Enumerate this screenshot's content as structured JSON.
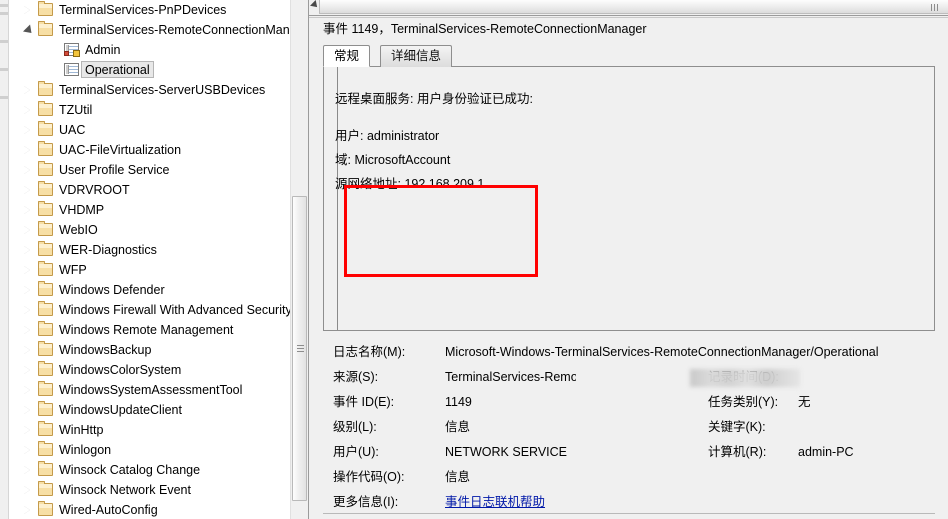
{
  "tree": {
    "name": "event-log-channel-tree",
    "items": [
      {
        "label": "TerminalServices-PnPDevices",
        "indent": 0,
        "state": "collapsed",
        "icon": "folder-icon"
      },
      {
        "label": "TerminalServices-RemoteConnectionMan",
        "indent": 0,
        "state": "expanded",
        "icon": "folder-icon"
      },
      {
        "label": "Admin",
        "indent": 1,
        "state": "leaf",
        "icon": "log-admin-icon"
      },
      {
        "label": "Operational",
        "indent": 1,
        "state": "leaf",
        "icon": "log-icon",
        "selected": true
      },
      {
        "label": "TerminalServices-ServerUSBDevices",
        "indent": 0,
        "state": "collapsed",
        "icon": "folder-icon"
      },
      {
        "label": "TZUtil",
        "indent": 0,
        "state": "collapsed",
        "icon": "folder-icon"
      },
      {
        "label": "UAC",
        "indent": 0,
        "state": "collapsed",
        "icon": "folder-icon"
      },
      {
        "label": "UAC-FileVirtualization",
        "indent": 0,
        "state": "collapsed",
        "icon": "folder-icon"
      },
      {
        "label": "User Profile Service",
        "indent": 0,
        "state": "collapsed",
        "icon": "folder-icon"
      },
      {
        "label": "VDRVROOT",
        "indent": 0,
        "state": "collapsed",
        "icon": "folder-icon"
      },
      {
        "label": "VHDMP",
        "indent": 0,
        "state": "collapsed",
        "icon": "folder-icon"
      },
      {
        "label": "WebIO",
        "indent": 0,
        "state": "collapsed",
        "icon": "folder-icon"
      },
      {
        "label": "WER-Diagnostics",
        "indent": 0,
        "state": "collapsed",
        "icon": "folder-icon"
      },
      {
        "label": "WFP",
        "indent": 0,
        "state": "collapsed",
        "icon": "folder-icon"
      },
      {
        "label": "Windows Defender",
        "indent": 0,
        "state": "collapsed",
        "icon": "folder-icon"
      },
      {
        "label": "Windows Firewall With Advanced Security",
        "indent": 0,
        "state": "collapsed",
        "icon": "folder-icon"
      },
      {
        "label": "Windows Remote Management",
        "indent": 0,
        "state": "collapsed",
        "icon": "folder-icon"
      },
      {
        "label": "WindowsBackup",
        "indent": 0,
        "state": "collapsed",
        "icon": "folder-icon"
      },
      {
        "label": "WindowsColorSystem",
        "indent": 0,
        "state": "collapsed",
        "icon": "folder-icon"
      },
      {
        "label": "WindowsSystemAssessmentTool",
        "indent": 0,
        "state": "collapsed",
        "icon": "folder-icon"
      },
      {
        "label": "WindowsUpdateClient",
        "indent": 0,
        "state": "collapsed",
        "icon": "folder-icon"
      },
      {
        "label": "WinHttp",
        "indent": 0,
        "state": "collapsed",
        "icon": "folder-icon"
      },
      {
        "label": "Winlogon",
        "indent": 0,
        "state": "collapsed",
        "icon": "folder-icon"
      },
      {
        "label": "Winsock Catalog Change",
        "indent": 0,
        "state": "collapsed",
        "icon": "folder-icon"
      },
      {
        "label": "Winsock Network Event",
        "indent": 0,
        "state": "collapsed",
        "icon": "folder-icon"
      },
      {
        "label": "Wired-AutoConfig",
        "indent": 0,
        "state": "collapsed",
        "icon": "folder-icon"
      }
    ]
  },
  "detail": {
    "event_title": "事件 1149，TerminalServices-RemoteConnectionManager",
    "tabs": [
      {
        "label": "常规",
        "active": true
      },
      {
        "label": "详细信息",
        "active": false
      }
    ],
    "description": {
      "heading": "远程桌面服务: 用户身份验证已成功:",
      "lines": [
        "用户: administrator",
        "域: MicrosoftAccount",
        "源网络地址: 192.168.209.1"
      ]
    },
    "annotation": {
      "shape": "rectangle",
      "color": "#ff0000"
    },
    "table": {
      "log_name_label": "日志名称(M):",
      "log_name_value": "Microsoft-Windows-TerminalServices-RemoteConnectionManager/Operational",
      "source_label": "来源(S):",
      "source_value": "TerminalServices-RemoteConnectionManager",
      "logged_label": "记录时间(D):",
      "logged_value": "",
      "event_id_label": "事件 ID(E):",
      "event_id_value": "1149",
      "task_category_label": "任务类别(Y):",
      "task_category_value": "无",
      "level_label": "级别(L):",
      "level_value": "信息",
      "keywords_label": "关键字(K):",
      "keywords_value": "",
      "user_label": "用户(U):",
      "user_value": "NETWORK SERVICE",
      "computer_label": "计算机(R):",
      "computer_value": "admin-PC",
      "opcode_label": "操作代码(O):",
      "opcode_value": "信息",
      "more_info_label": "更多信息(I):",
      "more_info_link": "事件日志联机帮助"
    }
  },
  "colors": {
    "annotation_red": "#ff0000",
    "link_blue": "#0018a8",
    "pane_bg": "#f0f0f0",
    "folder_yellow": "#f7dfa5"
  }
}
